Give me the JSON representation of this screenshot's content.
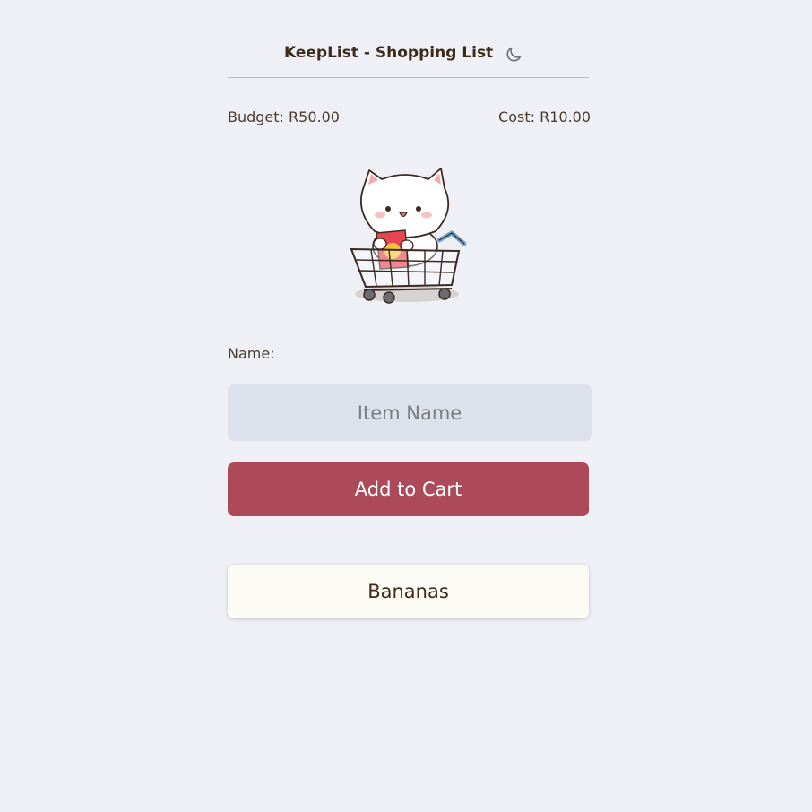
{
  "header": {
    "title": "KeepList - Shopping List",
    "theme_toggle_icon": "moon-icon"
  },
  "summary": {
    "budget": "Budget: R50.00",
    "cost": "Cost: R10.00"
  },
  "mascot": {
    "icon": "cat-in-shopping-cart-illustration"
  },
  "form": {
    "name_label": "Name:",
    "name_placeholder": "Item Name",
    "name_value": "",
    "add_button_label": "Add to Cart"
  },
  "items": [
    {
      "name": "Bananas"
    }
  ],
  "colors": {
    "background": "#eef0f5",
    "accent": "#ad4a5a",
    "input_bg": "#dde1ec",
    "item_bg": "#fcfbf6",
    "text": "#4a3b2e"
  }
}
